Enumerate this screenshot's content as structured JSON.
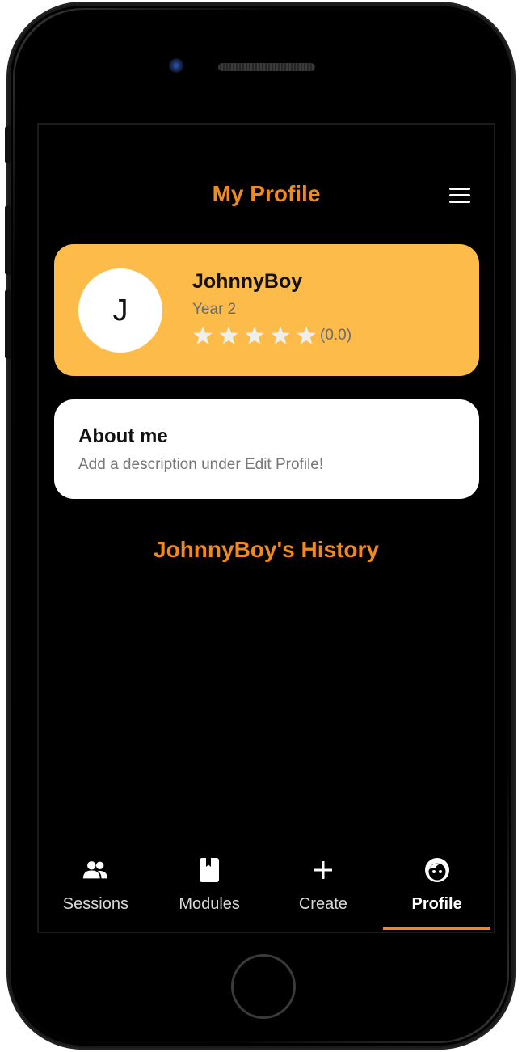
{
  "header": {
    "title": "My Profile"
  },
  "profile": {
    "avatar_initial": "J",
    "username": "JohnnyBoy",
    "year": "Year 2",
    "rating_value": 0.0,
    "rating_text": "(0.0)",
    "star_count": 5
  },
  "about": {
    "title": "About me",
    "description": "Add a description under Edit Profile!"
  },
  "history": {
    "title": "JohnnyBoy's History"
  },
  "nav": {
    "items": [
      {
        "label": "Sessions",
        "icon": "people-icon"
      },
      {
        "label": "Modules",
        "icon": "book-icon"
      },
      {
        "label": "Create",
        "icon": "plus-icon"
      },
      {
        "label": "Profile",
        "icon": "face-icon"
      }
    ],
    "active_index": 3
  },
  "colors": {
    "accent": "#f08a1c",
    "card_yellow": "#fdbb4a",
    "background": "#000000",
    "star_empty": "#eeeeee"
  }
}
